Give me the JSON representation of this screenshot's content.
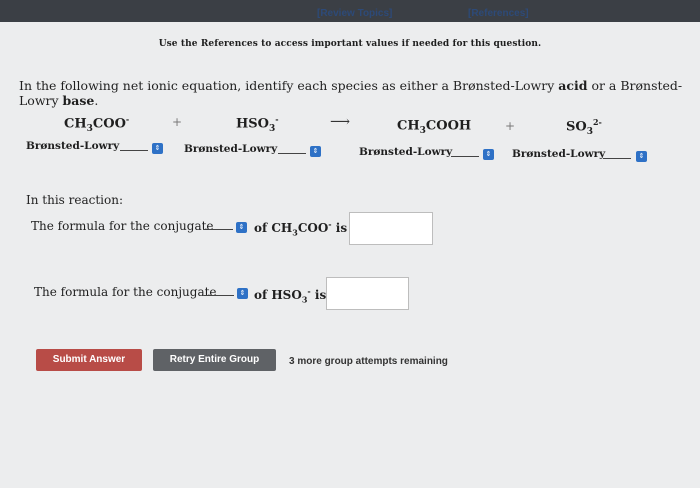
{
  "header": {
    "review_topics": "[Review Topics]",
    "references": "[References]",
    "notice": "Use the References to access important values if needed for this question."
  },
  "question": {
    "prompt_pre": "In the following net ionic equation, identify each species as either a Brønsted-Lowry ",
    "acid": "acid",
    "prompt_mid": " or a Brønsted-Lowry ",
    "base": "base",
    "prompt_end": "."
  },
  "equation": {
    "species": [
      {
        "main": "CH",
        "sub": "3",
        "rest": "COO",
        "sup": "-"
      },
      {
        "main": "HSO",
        "sub": "3",
        "rest": "",
        "sup": "-"
      },
      {
        "main": "CH",
        "sub": "3",
        "rest": "COOH",
        "sup": ""
      },
      {
        "main": "SO",
        "sub": "3",
        "rest": "",
        "sup": "2-"
      }
    ],
    "plus": "+",
    "arrow": "⟶",
    "bl_label": "Brønsted-Lowry"
  },
  "reaction": {
    "heading": "In this reaction:",
    "line1_prefix": "The formula for the conjugate",
    "line1_of": "of CH",
    "line1_sub": "3",
    "line1_rest": "COO",
    "line1_sup": "-",
    "line1_is": " is",
    "line2_prefix": "The formula for the conjugate",
    "line2_of": "of HSO",
    "line2_sub": "3",
    "line2_sup": "-",
    "line2_is": " is"
  },
  "footer": {
    "submit": "Submit Answer",
    "retry": "Retry Entire Group",
    "remaining": "3 more group attempts remaining"
  },
  "colors": {
    "submit_bg": "#b84c47",
    "retry_bg": "#5f6266",
    "select_button": "#2e71c6",
    "link": "#2d4a78"
  }
}
